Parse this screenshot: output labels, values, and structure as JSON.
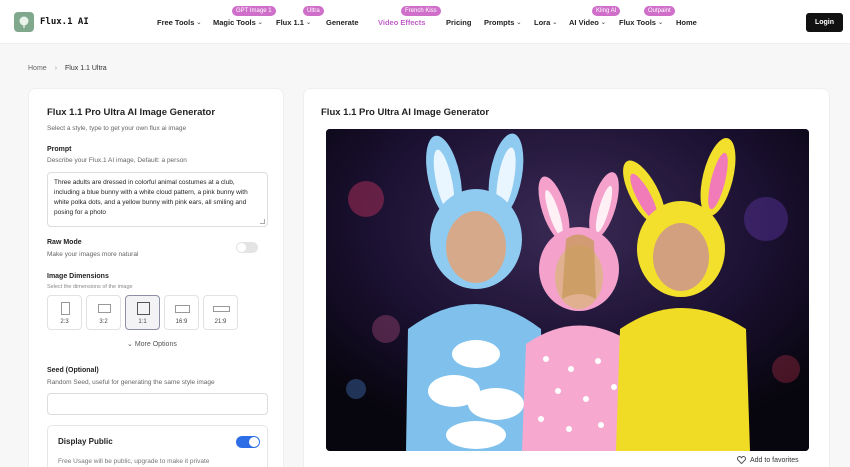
{
  "header": {
    "logo_text": "Flux.1 AI",
    "nav": [
      {
        "label": "Free Tools",
        "dropdown": true
      },
      {
        "label": "Magic Tools",
        "dropdown": true,
        "badge": "GPT Image 1"
      },
      {
        "label": "Flux 1.1",
        "dropdown": true,
        "badge": "Ultra"
      },
      {
        "label": "Generate",
        "dropdown": false
      },
      {
        "label": "Video Effects",
        "dropdown": false,
        "badge": "French Kiss"
      },
      {
        "label": "Pricing",
        "dropdown": false
      },
      {
        "label": "Prompts",
        "dropdown": true
      },
      {
        "label": "Lora",
        "dropdown": true
      },
      {
        "label": "AI Video",
        "dropdown": true,
        "badge": "Kling AI"
      },
      {
        "label": "Flux Tools",
        "dropdown": true,
        "badge": "Outpaint"
      },
      {
        "label": "Home",
        "dropdown": false
      }
    ],
    "login_label": "Login"
  },
  "breadcrumb": {
    "home": "Home",
    "current": "Flux 1.1 Ultra"
  },
  "form": {
    "title": "Flux 1.1 Pro Ultra AI Image Generator",
    "subtitle": "Select a style, type to get your own flux ai image",
    "prompt_label": "Prompt",
    "prompt_hint": "Describe your Flux.1 AI image, Default: a person",
    "prompt_value": "Three adults are dressed in colorful animal costumes at a club, including a blue bunny with a white cloud pattern, a pink bunny with white polka dots, and a yellow bunny with pink ears, all smiling and posing for a photo",
    "raw_label": "Raw Mode",
    "raw_hint": "Make your images more natural",
    "raw_enabled": false,
    "dims_label": "Image Dimensions",
    "dims_hint": "Select the dimensions of the image",
    "dims": [
      "2:3",
      "3:2",
      "1:1",
      "16:9",
      "21:9"
    ],
    "dims_selected": "1:1",
    "more_options": "More Options",
    "seed_label": "Seed (Optional)",
    "seed_hint": "Random Seed, useful for generating the same style image",
    "seed_value": "",
    "public_label": "Display Public",
    "public_note": "Free Usage will be public, upgrade to make it private",
    "public_enabled": true
  },
  "result": {
    "title": "Flux 1.1 Pro Ultra AI Image Generator",
    "favorites_label": "Add to favorites"
  },
  "colors": {
    "accent": "#2d6ee6",
    "badge": "#cf6fc9",
    "login_bg": "#111111"
  }
}
